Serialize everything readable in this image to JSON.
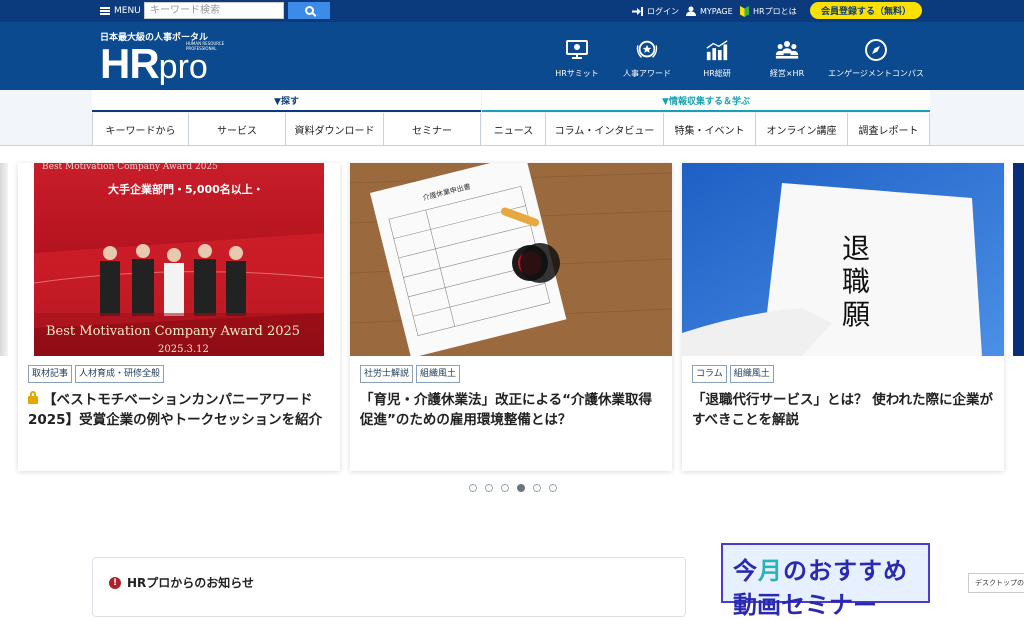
{
  "topbar": {
    "menu_label": "MENU",
    "search_placeholder": "キーワード検索",
    "login": "ログイン",
    "mypage": "MYPAGE",
    "about": "HRプロとは",
    "signup": "会員登録する（無料）"
  },
  "header": {
    "tagline": "日本最大級の人事ポータル",
    "logo_main": "HR",
    "logo_pro": "pro",
    "logo_sub": [
      "HUMAN RESOURCE",
      "PROFESSIONAL"
    ],
    "nav": [
      {
        "label": "HRサミット",
        "icon": "monitor-icon"
      },
      {
        "label": "人事アワード",
        "icon": "award-icon"
      },
      {
        "label": "HR総研",
        "icon": "chart-icon"
      },
      {
        "label": "経営×HR",
        "icon": "people-icon"
      },
      {
        "label": "エンゲージメントコンパス",
        "icon": "compass-icon"
      }
    ]
  },
  "subnav": {
    "left_head": "▼探す",
    "right_head": "▼情報収集する＆学ぶ",
    "left_items": [
      "キーワードから",
      "サービス",
      "資料ダウンロード",
      "セミナー"
    ],
    "right_items": [
      "ニュース",
      "コラム・インタビュー",
      "特集・イベント",
      "オンライン講座",
      "調査レポート"
    ]
  },
  "cards": [
    {
      "image_text": [
        "Best Motivation Company Award 2025",
        "大手企業部門・5,000名以上・",
        "Best Motivation Company Award 2025",
        "2025.3.12"
      ],
      "tags": [
        "取材記事",
        "人材育成・研修全般"
      ],
      "locked": true,
      "title": "【ベストモチベーションカンパニーアワード2025】受賞企業の例やトークセッションを紹介"
    },
    {
      "image_text": [
        "介護休業申出書"
      ],
      "tags": [
        "社労士解説",
        "組織風土"
      ],
      "locked": false,
      "title": "「育児・介護休業法」改正による“介護休業取得促進”のための雇用環境整備とは？"
    },
    {
      "image_text": [
        "退",
        "職",
        "願"
      ],
      "tags": [
        "コラム",
        "組織風土"
      ],
      "locked": false,
      "title": "「退職代行サービス」とは？ 使われた際に企業がすべきことを解説"
    }
  ],
  "carousel": {
    "dot_count": 6,
    "active_index": 3
  },
  "news": {
    "title": "HRプロからのお知らせ"
  },
  "banner": {
    "line1_a": "今",
    "line1_b": "月",
    "line1_c": "のおすすめ",
    "line2": "動画セミナー"
  },
  "desktop_toggle": "デスクトップの表示"
}
